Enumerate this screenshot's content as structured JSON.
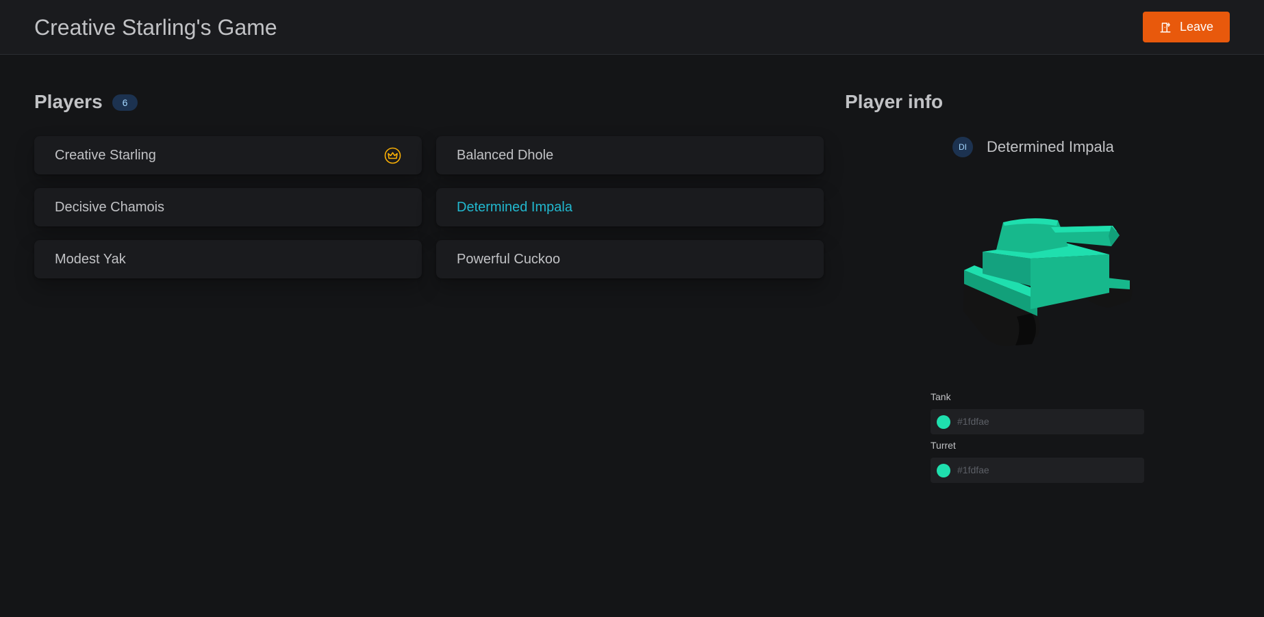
{
  "header": {
    "title": "Creative Starling's Game",
    "leave_label": "Leave",
    "leave_icon": "door-exit-icon",
    "leave_color": "#e8590c"
  },
  "players": {
    "title": "Players",
    "count": "6",
    "host_icon": "crown-icon",
    "host_icon_color": "#fab005",
    "selected_color": "#22b8cf",
    "items": [
      {
        "name": "Creative Starling",
        "host": true,
        "selected": false
      },
      {
        "name": "Balanced Dhole",
        "host": false,
        "selected": false
      },
      {
        "name": "Decisive Chamois",
        "host": false,
        "selected": false
      },
      {
        "name": "Determined Impala",
        "host": false,
        "selected": true
      },
      {
        "name": "Modest Yak",
        "host": false,
        "selected": false
      },
      {
        "name": "Powerful Cuckoo",
        "host": false,
        "selected": false
      }
    ]
  },
  "player_info": {
    "title": "Player info",
    "initials": "DI",
    "name": "Determined Impala",
    "tank_color": "#1fdfae",
    "fields": {
      "tank": {
        "label": "Tank",
        "value": "#1fdfae",
        "swatch": "#1fdfae"
      },
      "turret": {
        "label": "Turret",
        "value": "#1fdfae",
        "swatch": "#1fdfae"
      }
    }
  }
}
